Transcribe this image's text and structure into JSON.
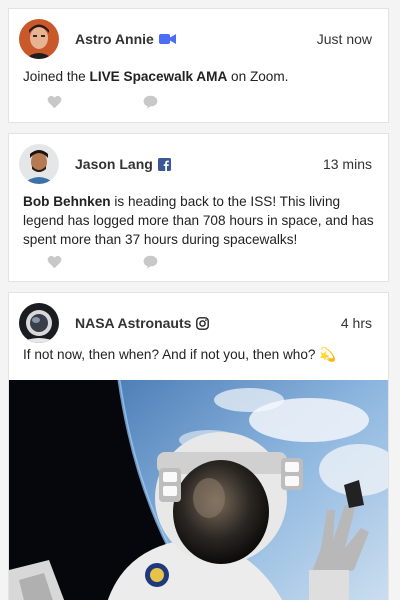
{
  "posts": [
    {
      "author": "Astro Annie",
      "source_icon": "video-camera-icon",
      "time": "Just now",
      "body": {
        "prefix": "Joined the ",
        "bold": "LIVE Spacewalk AMA",
        "suffix": " on Zoom."
      }
    },
    {
      "author": "Jason Lang",
      "source_icon": "facebook-icon",
      "time": "13 mins",
      "body": {
        "bold": "Bob Behnken",
        "suffix": " is heading back to the ISS! This living legend has logged more than 708 hours in space, and has spent more than 37 hours during spacewalks!"
      }
    },
    {
      "author": "NASA Astronauts",
      "source_icon": "instagram-icon",
      "time": "4 hrs",
      "body": {
        "text": "If not now, then when? And if not you, then who? 💫"
      },
      "image": "astronaut-spacewalk-photo"
    }
  ],
  "colors": {
    "zoom_blue": "#4a6cf7",
    "facebook_blue": "#3b5998",
    "icon_gray": "#c8c8c8",
    "space_black": "#05070c",
    "earth_blue": "#6fa8dc"
  }
}
